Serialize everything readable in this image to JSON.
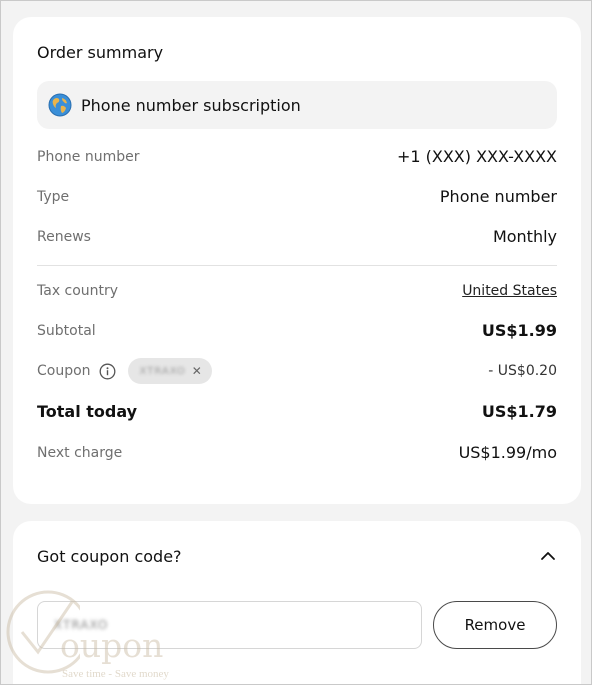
{
  "summary": {
    "title": "Order summary",
    "product": "Phone number subscription",
    "product_icon": "globe-icon",
    "rows": {
      "phone_number": {
        "label": "Phone number",
        "value": "+1 (XXX) XXX-XXXX"
      },
      "type": {
        "label": "Type",
        "value": "Phone number"
      },
      "renews": {
        "label": "Renews",
        "value": "Monthly"
      },
      "tax_country": {
        "label": "Tax country",
        "value": "United States"
      },
      "subtotal": {
        "label": "Subtotal",
        "value": "US$1.99"
      },
      "coupon": {
        "label": "Coupon",
        "code": "XTRAXO",
        "value": "- US$0.20"
      },
      "total": {
        "label": "Total today",
        "value": "US$1.79"
      },
      "next_charge": {
        "label": "Next charge",
        "value": "US$1.99/mo"
      }
    }
  },
  "coupon_section": {
    "title": "Got coupon code?",
    "input_value": "XTRAXO",
    "remove_label": "Remove"
  },
  "watermark": {
    "text": "oupon",
    "tagline": "Save time - Save money"
  },
  "colors": {
    "background": "#f3f3f3",
    "card": "#ffffff",
    "label": "#6f6f6f",
    "text": "#111111",
    "chip": "#e6e6e6"
  }
}
